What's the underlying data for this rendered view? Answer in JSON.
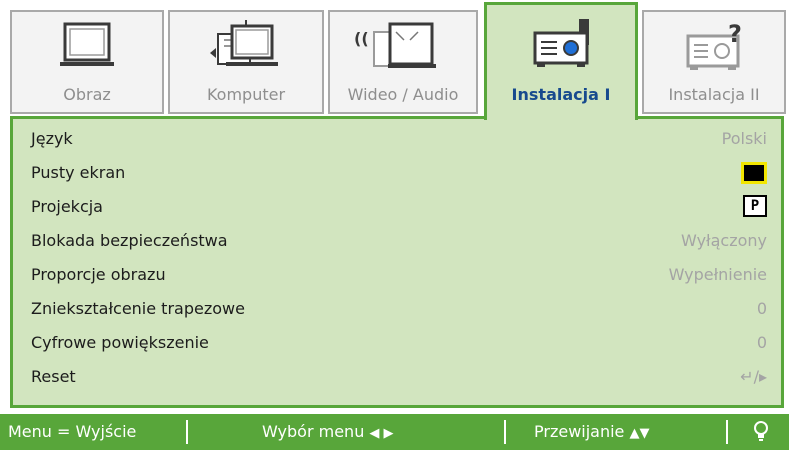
{
  "tabs": [
    {
      "label": "Obraz",
      "icon": "monitor-icon",
      "active": false
    },
    {
      "label": "Komputer",
      "icon": "computer-icon",
      "active": false
    },
    {
      "label": "Wideo / Audio",
      "icon": "video-audio-icon",
      "active": false
    },
    {
      "label": "Instalacja I",
      "icon": "projector-icon",
      "active": true
    },
    {
      "label": "Instalacja II",
      "icon": "projector-question-icon",
      "active": false
    }
  ],
  "menu": {
    "items": [
      {
        "label": "Język",
        "value": "Polski"
      },
      {
        "label": "Pusty ekran",
        "value_icon": "black-screen-swatch"
      },
      {
        "label": "Projekcja",
        "value": "P"
      },
      {
        "label": "Blokada bezpieczeństwa",
        "value": "Wyłączony"
      },
      {
        "label": "Proporcje obrazu",
        "value": "Wypełnienie"
      },
      {
        "label": "Zniekształcenie trapezowe",
        "value": "0"
      },
      {
        "label": "Cyfrowe powiększenie",
        "value": "0"
      },
      {
        "label": "Reset",
        "value": "↵/▸"
      }
    ]
  },
  "footer": {
    "exit": "Menu = Wyjście",
    "select": "Wybór menu",
    "select_arrows": "◀ ▶",
    "scroll": "Przewijanie",
    "scroll_arrows": "▲▼",
    "tip_icon": "bulb-icon"
  },
  "colors": {
    "accent_green": "#58a63a",
    "panel_green": "#d2e5bf",
    "active_tab_text": "#174a8e",
    "value_gray": "#a4a4a4"
  }
}
